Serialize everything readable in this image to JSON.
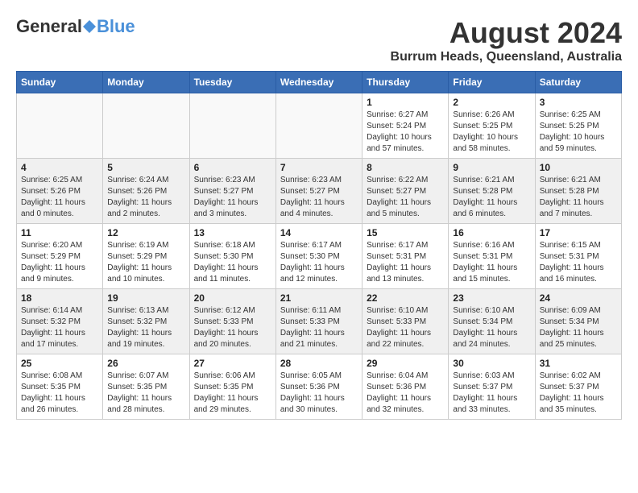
{
  "header": {
    "logo_general": "General",
    "logo_blue": "Blue",
    "month_year": "August 2024",
    "location": "Burrum Heads, Queensland, Australia"
  },
  "weekdays": [
    "Sunday",
    "Monday",
    "Tuesday",
    "Wednesday",
    "Thursday",
    "Friday",
    "Saturday"
  ],
  "weeks": [
    [
      {
        "day": "",
        "info": ""
      },
      {
        "day": "",
        "info": ""
      },
      {
        "day": "",
        "info": ""
      },
      {
        "day": "",
        "info": ""
      },
      {
        "day": "1",
        "info": "Sunrise: 6:27 AM\nSunset: 5:24 PM\nDaylight: 10 hours\nand 57 minutes."
      },
      {
        "day": "2",
        "info": "Sunrise: 6:26 AM\nSunset: 5:25 PM\nDaylight: 10 hours\nand 58 minutes."
      },
      {
        "day": "3",
        "info": "Sunrise: 6:25 AM\nSunset: 5:25 PM\nDaylight: 10 hours\nand 59 minutes."
      }
    ],
    [
      {
        "day": "4",
        "info": "Sunrise: 6:25 AM\nSunset: 5:26 PM\nDaylight: 11 hours\nand 0 minutes."
      },
      {
        "day": "5",
        "info": "Sunrise: 6:24 AM\nSunset: 5:26 PM\nDaylight: 11 hours\nand 2 minutes."
      },
      {
        "day": "6",
        "info": "Sunrise: 6:23 AM\nSunset: 5:27 PM\nDaylight: 11 hours\nand 3 minutes."
      },
      {
        "day": "7",
        "info": "Sunrise: 6:23 AM\nSunset: 5:27 PM\nDaylight: 11 hours\nand 4 minutes."
      },
      {
        "day": "8",
        "info": "Sunrise: 6:22 AM\nSunset: 5:27 PM\nDaylight: 11 hours\nand 5 minutes."
      },
      {
        "day": "9",
        "info": "Sunrise: 6:21 AM\nSunset: 5:28 PM\nDaylight: 11 hours\nand 6 minutes."
      },
      {
        "day": "10",
        "info": "Sunrise: 6:21 AM\nSunset: 5:28 PM\nDaylight: 11 hours\nand 7 minutes."
      }
    ],
    [
      {
        "day": "11",
        "info": "Sunrise: 6:20 AM\nSunset: 5:29 PM\nDaylight: 11 hours\nand 9 minutes."
      },
      {
        "day": "12",
        "info": "Sunrise: 6:19 AM\nSunset: 5:29 PM\nDaylight: 11 hours\nand 10 minutes."
      },
      {
        "day": "13",
        "info": "Sunrise: 6:18 AM\nSunset: 5:30 PM\nDaylight: 11 hours\nand 11 minutes."
      },
      {
        "day": "14",
        "info": "Sunrise: 6:17 AM\nSunset: 5:30 PM\nDaylight: 11 hours\nand 12 minutes."
      },
      {
        "day": "15",
        "info": "Sunrise: 6:17 AM\nSunset: 5:31 PM\nDaylight: 11 hours\nand 13 minutes."
      },
      {
        "day": "16",
        "info": "Sunrise: 6:16 AM\nSunset: 5:31 PM\nDaylight: 11 hours\nand 15 minutes."
      },
      {
        "day": "17",
        "info": "Sunrise: 6:15 AM\nSunset: 5:31 PM\nDaylight: 11 hours\nand 16 minutes."
      }
    ],
    [
      {
        "day": "18",
        "info": "Sunrise: 6:14 AM\nSunset: 5:32 PM\nDaylight: 11 hours\nand 17 minutes."
      },
      {
        "day": "19",
        "info": "Sunrise: 6:13 AM\nSunset: 5:32 PM\nDaylight: 11 hours\nand 19 minutes."
      },
      {
        "day": "20",
        "info": "Sunrise: 6:12 AM\nSunset: 5:33 PM\nDaylight: 11 hours\nand 20 minutes."
      },
      {
        "day": "21",
        "info": "Sunrise: 6:11 AM\nSunset: 5:33 PM\nDaylight: 11 hours\nand 21 minutes."
      },
      {
        "day": "22",
        "info": "Sunrise: 6:10 AM\nSunset: 5:33 PM\nDaylight: 11 hours\nand 22 minutes."
      },
      {
        "day": "23",
        "info": "Sunrise: 6:10 AM\nSunset: 5:34 PM\nDaylight: 11 hours\nand 24 minutes."
      },
      {
        "day": "24",
        "info": "Sunrise: 6:09 AM\nSunset: 5:34 PM\nDaylight: 11 hours\nand 25 minutes."
      }
    ],
    [
      {
        "day": "25",
        "info": "Sunrise: 6:08 AM\nSunset: 5:35 PM\nDaylight: 11 hours\nand 26 minutes."
      },
      {
        "day": "26",
        "info": "Sunrise: 6:07 AM\nSunset: 5:35 PM\nDaylight: 11 hours\nand 28 minutes."
      },
      {
        "day": "27",
        "info": "Sunrise: 6:06 AM\nSunset: 5:35 PM\nDaylight: 11 hours\nand 29 minutes."
      },
      {
        "day": "28",
        "info": "Sunrise: 6:05 AM\nSunset: 5:36 PM\nDaylight: 11 hours\nand 30 minutes."
      },
      {
        "day": "29",
        "info": "Sunrise: 6:04 AM\nSunset: 5:36 PM\nDaylight: 11 hours\nand 32 minutes."
      },
      {
        "day": "30",
        "info": "Sunrise: 6:03 AM\nSunset: 5:37 PM\nDaylight: 11 hours\nand 33 minutes."
      },
      {
        "day": "31",
        "info": "Sunrise: 6:02 AM\nSunset: 5:37 PM\nDaylight: 11 hours\nand 35 minutes."
      }
    ]
  ]
}
